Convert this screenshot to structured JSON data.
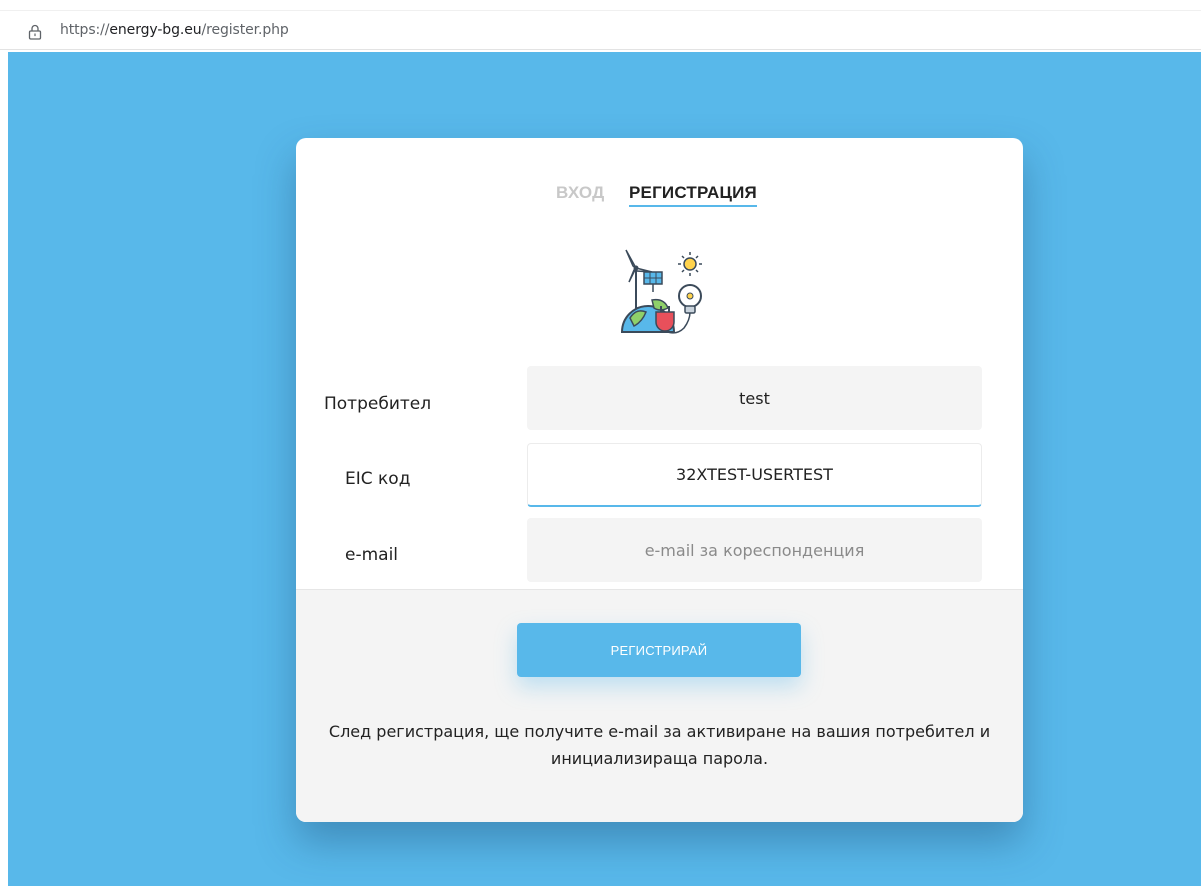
{
  "browser": {
    "url_scheme": "https://",
    "url_host": "energy-bg.eu",
    "url_path": "/register.php",
    "icon": "lock-icon"
  },
  "colors": {
    "accent": "#58b8ea",
    "background": "#58b8ea",
    "card": "#ffffff",
    "field": "#f4f4f4"
  },
  "tabs": {
    "login": "ВХОД",
    "register": "РЕГИСТРАЦИЯ",
    "active": "register"
  },
  "illustration": "renewable-energy-icon",
  "form": {
    "user": {
      "label": "Потребител",
      "value": "test"
    },
    "eic": {
      "label": "EIC код",
      "value": "32XTEST-USERTEST"
    },
    "email": {
      "label": "e-mail",
      "value": "",
      "placeholder": "e-mail за кореспонденция"
    }
  },
  "submit_label": "РЕГИСТРИРАЙ",
  "note": "След регистрация, ще получите e-mail за активиране на вашия потребител и инициализираща парола."
}
